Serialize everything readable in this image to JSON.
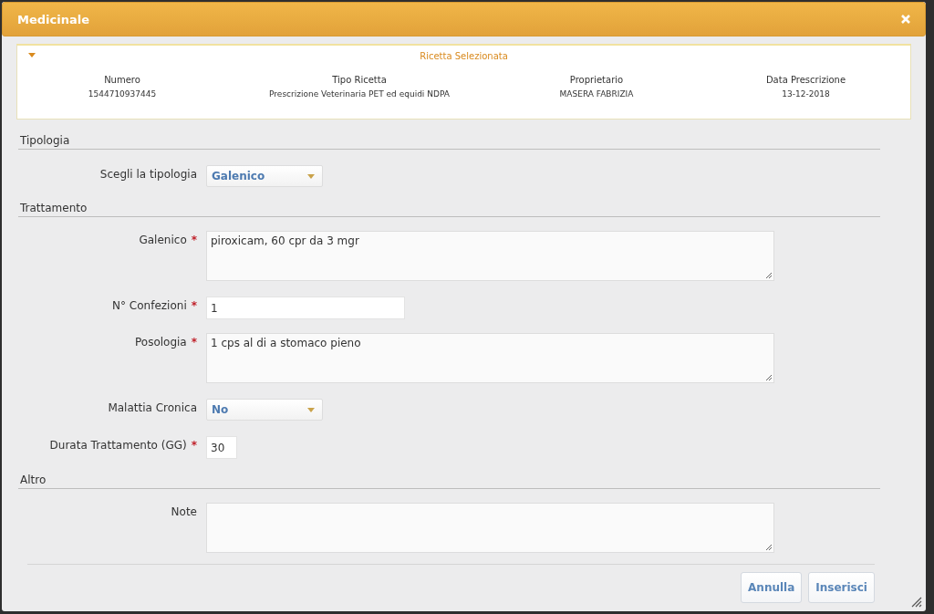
{
  "window": {
    "title": "Medicinale"
  },
  "summary": {
    "title": "Ricetta Selezionata",
    "expanded": true,
    "columns": [
      {
        "label": "Numero",
        "value": "1544710937445"
      },
      {
        "label": "Tipo Ricetta",
        "value": "Prescrizione Veterinaria PET ed equidi NDPA"
      },
      {
        "label": "Proprietario",
        "value": "MASERA FABRIZIA"
      },
      {
        "label": "Data Prescrizione",
        "value": "13-12-2018"
      }
    ]
  },
  "sections": [
    {
      "title": "Tipologia",
      "fields": [
        {
          "kind": "select",
          "label": "Scegli la tipologia",
          "value": "Galenico"
        }
      ]
    },
    {
      "title": "Trattamento",
      "fields": [
        {
          "kind": "textarea",
          "label": "Galenico",
          "required_mark": "*",
          "value": "piroxicam, 60 cpr da 3 mgr"
        },
        {
          "kind": "input",
          "label": "N° Confezioni",
          "required_mark": "*",
          "value": "1"
        },
        {
          "kind": "textarea",
          "label": "Posologia",
          "required_mark": "*",
          "value": "1 cps al di a stomaco pieno"
        },
        {
          "kind": "select",
          "label": "Malattia Cronica",
          "value": "No"
        },
        {
          "kind": "short",
          "label": "Durata Trattamento (GG)",
          "required_mark": "*",
          "value": "30"
        }
      ]
    },
    {
      "title": "Altro",
      "fields": [
        {
          "kind": "textarea",
          "label": "Note"
        }
      ]
    }
  ],
  "buttons": [
    "Annulla",
    "Inserisci"
  ]
}
